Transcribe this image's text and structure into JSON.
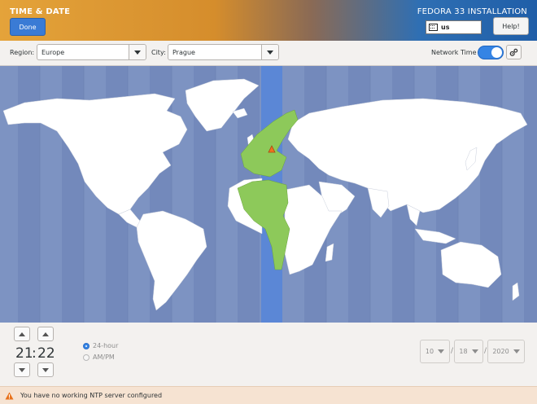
{
  "header": {
    "title": "TIME & DATE",
    "done_label": "Done",
    "install_title": "FEDORA 33 INSTALLATION",
    "keyboard_layout": "us",
    "help_label": "Help!"
  },
  "controls": {
    "region_label": "Region:",
    "region_value": "Europe",
    "city_label": "City:",
    "city_value": "Prague",
    "network_time_label": "Network Time",
    "network_time_on": true
  },
  "time": {
    "hours": "21",
    "separator": ":",
    "minutes": "22",
    "format_24": "24-hour",
    "format_ampm": "AM/PM",
    "selected_format": "24-hour"
  },
  "date": {
    "month": "10",
    "day": "18",
    "year": "2020",
    "separator": "/"
  },
  "status": {
    "message": "You have no working NTP server configured"
  },
  "colors": {
    "accent": "#3584e4",
    "selected_zone": "#5b87d6",
    "selected_country": "#8dc95a",
    "land": "#ffffff",
    "ocean": "#7d93c2",
    "warning": "#e8711a"
  }
}
